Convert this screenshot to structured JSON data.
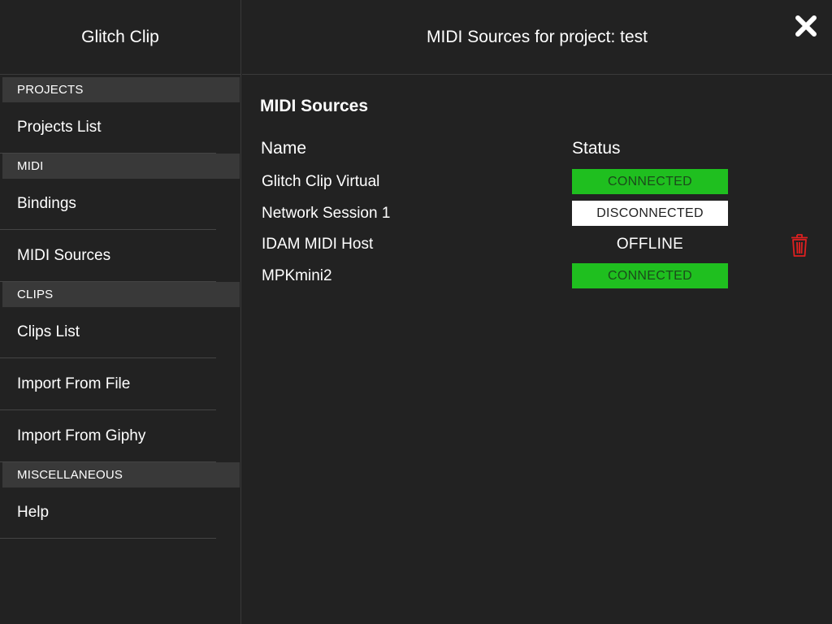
{
  "sidebar": {
    "app_title": "Glitch Clip",
    "sections": [
      {
        "header": "PROJECTS",
        "items": [
          "Projects List"
        ]
      },
      {
        "header": "MIDI",
        "items": [
          "Bindings",
          "MIDI Sources"
        ]
      },
      {
        "header": "CLIPS",
        "items": [
          "Clips List",
          "Import From File",
          "Import From Giphy"
        ]
      },
      {
        "header": "MISCELLANEOUS",
        "items": [
          "Help"
        ]
      }
    ]
  },
  "header": {
    "title": "MIDI Sources for project: test",
    "close_icon": "close-icon"
  },
  "content": {
    "title": "MIDI Sources",
    "columns": {
      "name": "Name",
      "status": "Status"
    },
    "rows": [
      {
        "name": "Glitch Clip Virtual",
        "status": "CONNECTED"
      },
      {
        "name": "Network Session 1",
        "status": "DISCONNECTED"
      },
      {
        "name": "IDAM MIDI Host",
        "status": "OFFLINE"
      },
      {
        "name": "MPKmini2",
        "status": "CONNECTED"
      }
    ]
  },
  "colors": {
    "background": "#222222",
    "section_header": "#393939",
    "connected": "#1fbf1f",
    "disconnected": "#ffffff",
    "delete": "#e02020"
  }
}
